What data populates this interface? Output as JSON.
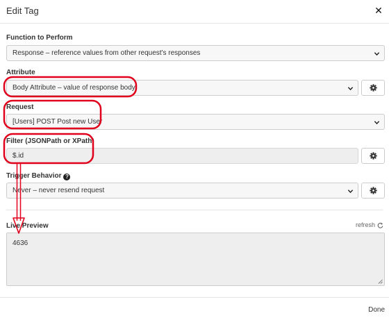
{
  "dialog": {
    "title": "Edit Tag",
    "close_icon": "close-icon"
  },
  "function": {
    "label": "Function to Perform",
    "value": "Response – reference values from other request's responses"
  },
  "attribute": {
    "label": "Attribute",
    "value": "Body Attribute – value of response body"
  },
  "request": {
    "label": "Request",
    "value": "[Users] POST Post new User"
  },
  "filter": {
    "label": "Filter (JSONPath or XPath)",
    "value": "$.id"
  },
  "trigger": {
    "label": "Trigger Behavior",
    "value": "Never – never resend request",
    "help_icon": "question-circle-icon"
  },
  "preview": {
    "label": "Live Preview",
    "refresh_label": "refresh",
    "value": "4636"
  },
  "footer": {
    "done_label": "Done"
  },
  "colors": {
    "annotation": "#e0001b",
    "field_bg": "#f7f7f7",
    "readonly_bg": "#eeeeee",
    "border": "#cccccc"
  }
}
